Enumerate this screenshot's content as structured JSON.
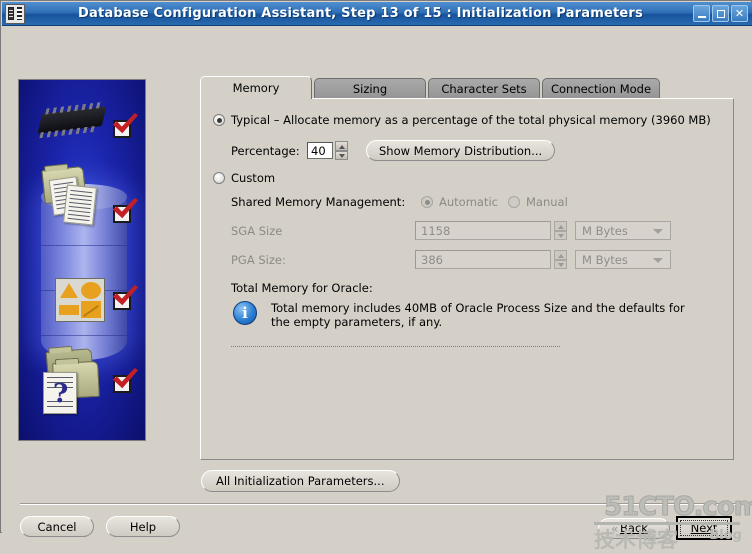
{
  "window": {
    "title": "Database Configuration Assistant, Step 13 of 15 : Initialization Parameters",
    "icon": "app-icon",
    "minimize_label": "_",
    "maximize_label": "□",
    "close_label": "✕"
  },
  "tabs": [
    {
      "label": "Memory",
      "selected": true
    },
    {
      "label": "Sizing",
      "selected": false
    },
    {
      "label": "Character Sets",
      "selected": false
    },
    {
      "label": "Connection Mode",
      "selected": false
    }
  ],
  "memory_tab": {
    "typical": {
      "label": "Typical – Allocate memory as a percentage of the total physical memory (3960 MB)",
      "selected": true,
      "percentage_label": "Percentage:",
      "percentage_value": "40",
      "show_distribution_button": "Show Memory Distribution..."
    },
    "custom": {
      "label": "Custom",
      "selected": false,
      "shared_memory_label": "Shared Memory Management:",
      "automatic_label": "Automatic",
      "automatic_selected": true,
      "manual_label": "Manual",
      "manual_selected": false,
      "sga_label": "SGA Size",
      "sga_value": "1158",
      "sga_unit": "M Bytes",
      "pga_label": "PGA Size:",
      "pga_value": "386",
      "pga_unit": "M Bytes"
    },
    "total_memory": {
      "heading": "Total Memory for Oracle:",
      "info_icon": "info-icon",
      "info_text": "Total memory includes 40MB of Oracle Process Size and the defaults for the empty parameters, if any."
    }
  },
  "all_params_button": "All Initialization Parameters...",
  "footer": {
    "cancel": "Cancel",
    "help": "Help",
    "back": "Back",
    "back_accel": "B",
    "next": "Next",
    "next_accel": "N"
  },
  "watermark": {
    "top": "51CTO.com",
    "cn": "技术博客",
    "blog": "Blog"
  },
  "side_art": {
    "name": "oracle-database-illustration",
    "checks": 4
  },
  "colors": {
    "title_bar": "#2f6fb5",
    "panel": "#d4d0c8",
    "tab_unselected": "#9a9a9a",
    "accent_blue": "#2b7fd4",
    "check_red": "#c32025"
  }
}
